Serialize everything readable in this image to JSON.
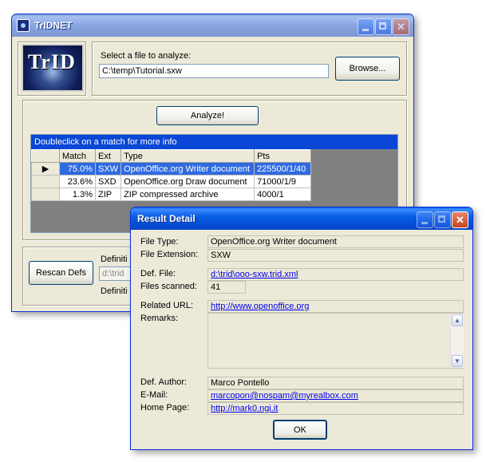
{
  "main_window": {
    "title": "TrIDNET",
    "logo_text": "TrID",
    "select_label": "Select a file to analyze:",
    "file_path": "C:\\temp\\Tutorial.sxw",
    "browse_label": "Browse...",
    "analyze_label": "Analyze!",
    "grid_caption": "Doubleclick on a match for more info",
    "columns": [
      "Match",
      "Ext",
      "Type",
      "Pts"
    ],
    "rows": [
      {
        "match": "75.0%",
        "ext": "SXW",
        "type": "OpenOffice.org Writer document",
        "pts": "225500/1/40"
      },
      {
        "match": "23.6%",
        "ext": "SXD",
        "type": "OpenOffice.org Draw document",
        "pts": "71000/1/9"
      },
      {
        "match": "1.3%",
        "ext": "ZIP",
        "type": "ZIP compressed archive",
        "pts": "4000/1"
      }
    ],
    "rescan_label": "Rescan Defs",
    "defs_label_1": "Definiti",
    "defs_path": "d:\\trid",
    "defs_label_2": "Definiti"
  },
  "detail_window": {
    "title": "Result Detail",
    "file_type_label": "File Type:",
    "file_type": "OpenOffice.org Writer document",
    "file_ext_label": "File Extension:",
    "file_ext": "SXW",
    "def_file_label": "Def. File:",
    "def_file": "d:\\trid\\ooo-sxw.trid.xml",
    "files_scanned_label": "Files scanned:",
    "files_scanned": "41",
    "related_url_label": "Related URL:",
    "related_url": "http://www.openoffice.org",
    "remarks_label": "Remarks:",
    "remarks": "",
    "def_author_label": "Def. Author:",
    "def_author": "Marco Pontello",
    "email_label": "E-Mail:",
    "email": "marcopon@nospam@myrealbox.com",
    "home_page_label": "Home Page:",
    "home_page": "http://mark0.ngi.it",
    "ok_label": "OK"
  }
}
